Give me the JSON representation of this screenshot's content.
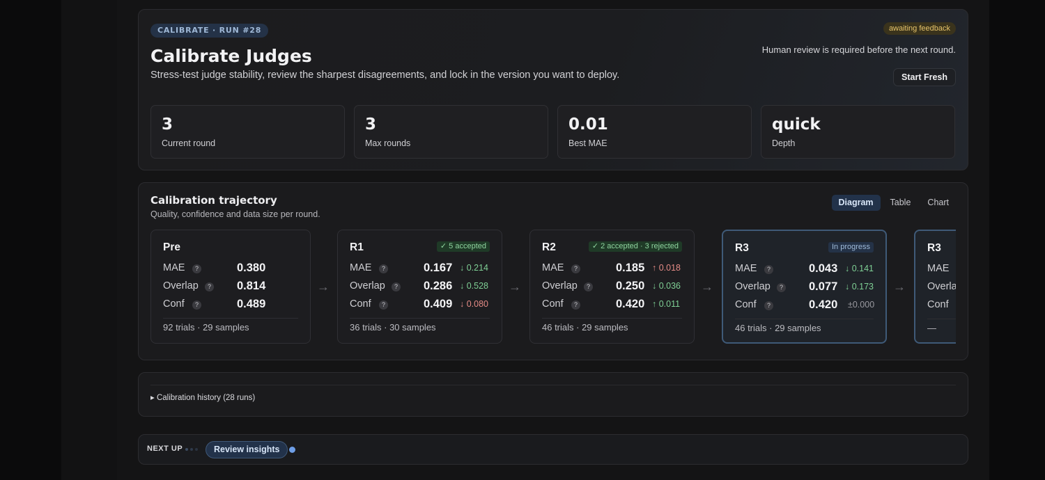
{
  "hero": {
    "run_badge": "CALIBRATE · RUN #28",
    "title": "Calibrate Judges",
    "subtitle": "Stress-test judge stability, review the sharpest disagreements, and lock in the version you want to deploy.",
    "status_badge": "awaiting feedback",
    "status_note": "Human review is required before the next round.",
    "start_fresh_label": "Start Fresh",
    "stats": [
      {
        "value": "3",
        "label": "Current round"
      },
      {
        "value": "3",
        "label": "Max rounds"
      },
      {
        "value": "0.01",
        "label": "Best MAE"
      },
      {
        "value": "quick",
        "label": "Depth"
      }
    ]
  },
  "trajectory": {
    "title": "Calibration trajectory",
    "subtitle": "Quality, confidence and data size per round.",
    "tabs": [
      "Diagram",
      "Table",
      "Chart"
    ],
    "active_tab": "Diagram",
    "rounds": [
      {
        "name": "Pre",
        "badge": "",
        "metrics": [
          {
            "label": "MAE",
            "value": "0.380",
            "delta": ""
          },
          {
            "label": "Overlap",
            "value": "0.814",
            "delta": ""
          },
          {
            "label": "Conf",
            "value": "0.489",
            "delta": ""
          }
        ],
        "footer": "92 trials · 29 samples"
      },
      {
        "name": "R1",
        "badge": "✓ 5 accepted",
        "metrics": [
          {
            "label": "MAE",
            "value": "0.167",
            "delta": "↓ 0.214"
          },
          {
            "label": "Overlap",
            "value": "0.286",
            "delta": "↓ 0.528"
          },
          {
            "label": "Conf",
            "value": "0.409",
            "delta": "↓ 0.080"
          }
        ],
        "footer": "36 trials · 30 samples"
      },
      {
        "name": "R2",
        "badge": "✓ 2 accepted · 3 rejected",
        "metrics": [
          {
            "label": "MAE",
            "value": "0.185",
            "delta": "↑ 0.018"
          },
          {
            "label": "Overlap",
            "value": "0.250",
            "delta": "↓ 0.036"
          },
          {
            "label": "Conf",
            "value": "0.420",
            "delta": "↑ 0.011"
          }
        ],
        "footer": "46 trials · 29 samples"
      },
      {
        "name": "R3",
        "badge": "In progress",
        "metrics": [
          {
            "label": "MAE",
            "value": "0.043",
            "delta": "↓ 0.141"
          },
          {
            "label": "Overlap",
            "value": "0.077",
            "delta": "↓ 0.173"
          },
          {
            "label": "Conf",
            "value": "0.420",
            "delta": "±0.000"
          }
        ],
        "footer": "46 trials · 29 samples"
      },
      {
        "name": "R3",
        "badge": "",
        "metrics": [
          {
            "label": "MAE",
            "value": "",
            "delta": ""
          },
          {
            "label": "Overlap",
            "value": "",
            "delta": ""
          },
          {
            "label": "Conf",
            "value": "",
            "delta": ""
          }
        ],
        "footer": "—"
      }
    ],
    "arrow": "→"
  },
  "history": {
    "toggle_label": "▸ Calibration history (28 runs)"
  },
  "next_up": {
    "label": "NEXT UP",
    "button_label": "Review insights"
  },
  "colors": {
    "accent": "#6e9ee6",
    "good": "#7fd095",
    "bad": "#e58b86",
    "warning": "#e7c46a"
  }
}
